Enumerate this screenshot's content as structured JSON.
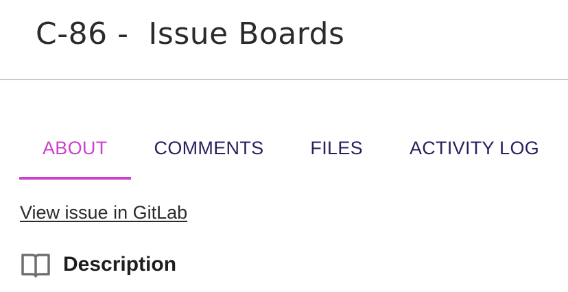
{
  "issue": {
    "title": "C-86 -  Issue Boards"
  },
  "tabs": [
    {
      "label": "ABOUT",
      "active": true
    },
    {
      "label": "COMMENTS",
      "active": false
    },
    {
      "label": "FILES",
      "active": false
    },
    {
      "label": "ACTIVITY LOG",
      "active": false
    }
  ],
  "links": {
    "gitlab": "View issue in GitLab"
  },
  "description": {
    "heading": "Description",
    "icon": "book-open-icon"
  },
  "colors": {
    "active_tab": "#cc3fcc",
    "tab_text": "#2a1e5c",
    "divider": "#c9c9c9"
  }
}
